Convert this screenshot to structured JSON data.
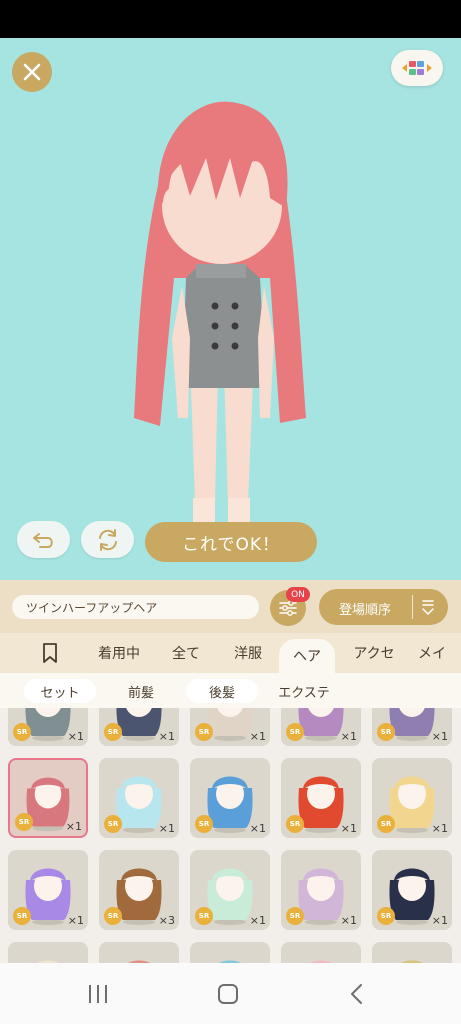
{
  "toolbar": {
    "selected_item_name": "ツインハーフアップヘア",
    "filter_badge": "ON",
    "sort_label": "登場順序"
  },
  "confirm_button": "これでOK！",
  "tabs": [
    {
      "label": "着用中"
    },
    {
      "label": "全て"
    },
    {
      "label": "洋服"
    },
    {
      "label": "ヘア"
    },
    {
      "label": "アクセ"
    },
    {
      "label": "メイ"
    }
  ],
  "subtabs": [
    {
      "label": "セット"
    },
    {
      "label": "前髪"
    },
    {
      "label": "後髪"
    },
    {
      "label": "エクステ"
    }
  ],
  "items": [
    {
      "rarity": "SR",
      "count": "×1",
      "hair_color": "#7f8f92"
    },
    {
      "rarity": "SR",
      "count": "×1",
      "hair_color": "#4c5570"
    },
    {
      "rarity": "SR",
      "count": "×1",
      "hair_color": "#e0d4c6"
    },
    {
      "rarity": "SR",
      "count": "×1",
      "hair_color": "#b48ac0"
    },
    {
      "rarity": "SR",
      "count": "×1",
      "hair_color": "#8e7fb0"
    },
    {
      "rarity": "SR",
      "count": "×1",
      "hair_color": "#d9777e"
    },
    {
      "rarity": "SR",
      "count": "×1",
      "hair_color": "#b8e6ef"
    },
    {
      "rarity": "SR",
      "count": "×1",
      "hair_color": "#5b9fd8"
    },
    {
      "rarity": "SR",
      "count": "×1",
      "hair_color": "#e14a2e"
    },
    {
      "rarity": "SR",
      "count": "×1",
      "hair_color": "#f2d690"
    },
    {
      "rarity": "SR",
      "count": "×1",
      "hair_color": "#a889e6"
    },
    {
      "rarity": "SR",
      "count": "×3",
      "hair_color": "#a16a3c"
    },
    {
      "rarity": "SR",
      "count": "×1",
      "hair_color": "#c9ecd8"
    },
    {
      "rarity": "SR",
      "count": "×1",
      "hair_color": "#d1b6d8"
    },
    {
      "rarity": "SR",
      "count": "×1",
      "hair_color": "#28304a"
    },
    {
      "rarity": "",
      "count": "",
      "hair_color": "#efe4d0"
    },
    {
      "rarity": "",
      "count": "",
      "hair_color": "#e88a86"
    },
    {
      "rarity": "",
      "count": "",
      "hair_color": "#7fc8d8"
    },
    {
      "rarity": "",
      "count": "",
      "hair_color": "#f2b8c6"
    },
    {
      "rarity": "",
      "count": "",
      "hair_color": "#d8c27a"
    }
  ],
  "colors": {
    "stage_bg": "#a6e4e2",
    "accent_gold": "#c9a862",
    "avatar_hair": "#e8797c",
    "selected_border": "#e8778a"
  }
}
